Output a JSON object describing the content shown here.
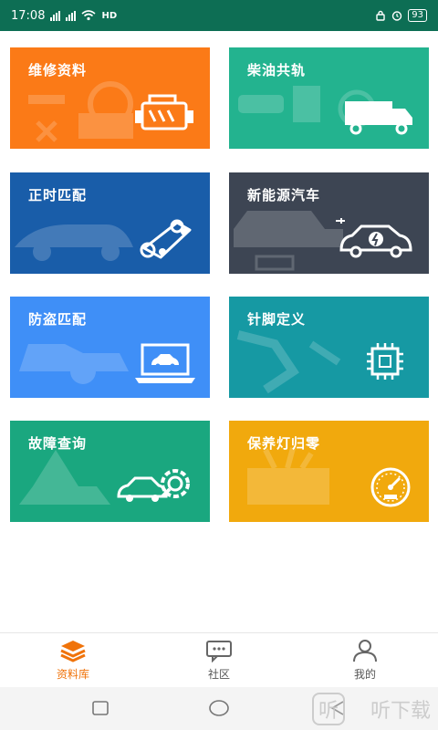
{
  "status_bar": {
    "time": "17:08",
    "network_label": "HD",
    "battery_level": "93"
  },
  "tiles": [
    {
      "label": "维修资料",
      "color": "#fb7a17",
      "icon": "engine-icon"
    },
    {
      "label": "柴油共轨",
      "color": "#23b38f",
      "icon": "truck-icon"
    },
    {
      "label": "正时匹配",
      "color": "#195da9",
      "icon": "timing-belt-icon"
    },
    {
      "label": "新能源汽车",
      "color": "#3d4553",
      "icon": "electric-car-icon"
    },
    {
      "label": "防盗匹配",
      "color": "#3f8ff7",
      "icon": "laptop-car-icon"
    },
    {
      "label": "针脚定义",
      "color": "#1699a3",
      "icon": "chip-icon"
    },
    {
      "label": "故障查询",
      "color": "#1aa77f",
      "icon": "car-search-icon"
    },
    {
      "label": "保养灯归零",
      "color": "#f1a90d",
      "icon": "speedometer-icon"
    }
  ],
  "bottom_nav": [
    {
      "label": "资料库",
      "icon": "layers-icon",
      "active": true
    },
    {
      "label": "社区",
      "icon": "chat-icon",
      "active": false
    },
    {
      "label": "我的",
      "icon": "person-icon",
      "active": false
    }
  ],
  "watermark": {
    "badge": "听",
    "text": "听下载"
  },
  "colors": {
    "status_bar": "#0d6e54",
    "nav_active": "#f0730a"
  }
}
